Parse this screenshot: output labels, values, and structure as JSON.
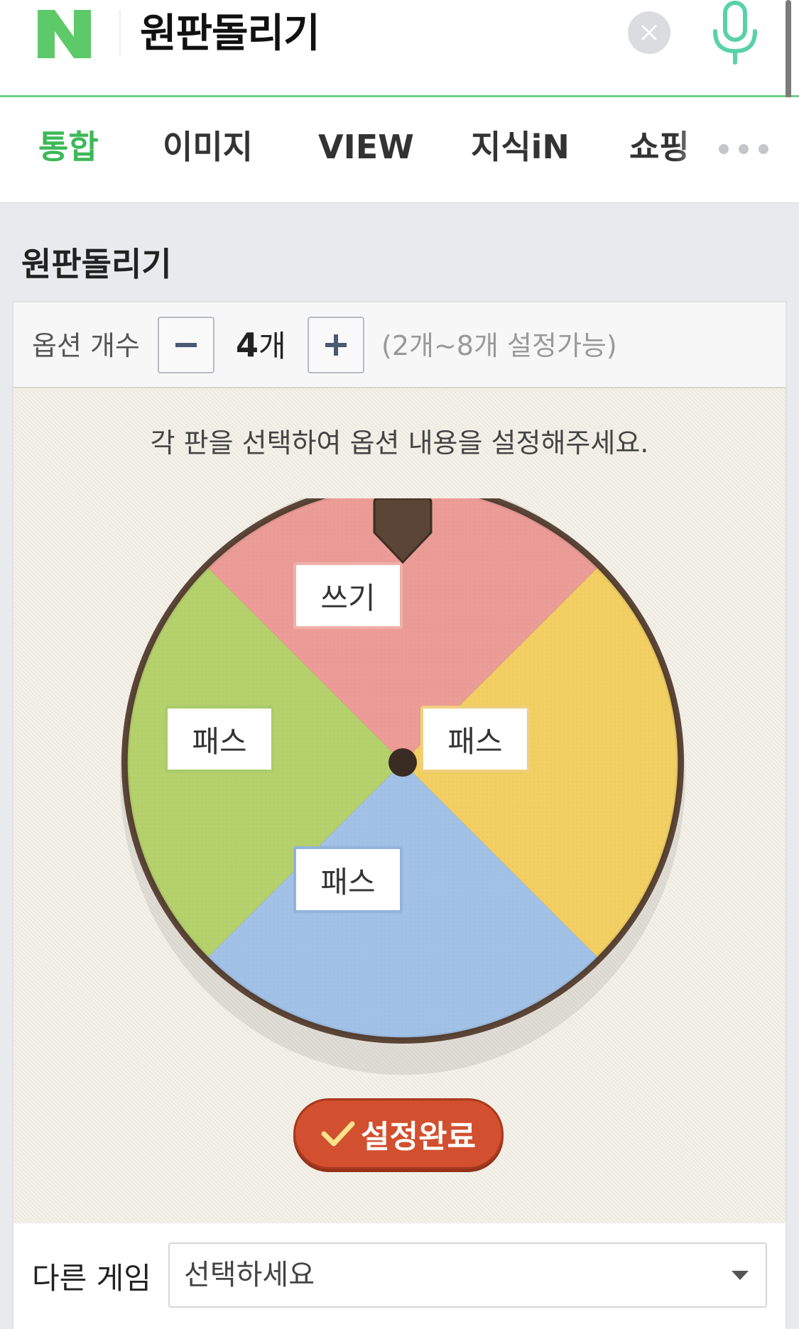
{
  "header": {
    "logo_text": "N",
    "query": "원판돌리기",
    "icons": {
      "logo": "naver-logo",
      "clear": "close-icon",
      "mic": "microphone-icon"
    },
    "colors": {
      "brand": "#03c75a",
      "mic": "#5ad1a6"
    }
  },
  "tabs": {
    "items": [
      {
        "label": "통합",
        "active": true
      },
      {
        "label": "이미지",
        "active": false
      },
      {
        "label": "VIEW",
        "active": false
      },
      {
        "label": "지식iN",
        "active": false
      },
      {
        "label": "쇼핑",
        "active": false
      }
    ],
    "more_icon": "more-dots-icon"
  },
  "section": {
    "title": "원판돌리기"
  },
  "options": {
    "label": "옵션 개수",
    "count": "4",
    "unit": "개",
    "range_hint": "(2개~8개 설정가능)",
    "minus_icon": "minus-icon",
    "plus_icon": "plus-icon"
  },
  "board": {
    "instruction": "각 판을 선택하여 옵션 내용을 설정해주세요.",
    "slices": [
      {
        "label": "쓰기",
        "color": "#eb9c96"
      },
      {
        "label": "패스",
        "color": "#f2cf62"
      },
      {
        "label": "패스",
        "color": "#a1c2e6"
      },
      {
        "label": "패스",
        "color": "#b5d16c"
      }
    ],
    "confirm_label": "설정완료",
    "confirm_icon": "check-icon"
  },
  "other_game": {
    "label": "다른 게임",
    "select_value": "선택하세요",
    "arrow_icon": "caret-down-icon"
  }
}
